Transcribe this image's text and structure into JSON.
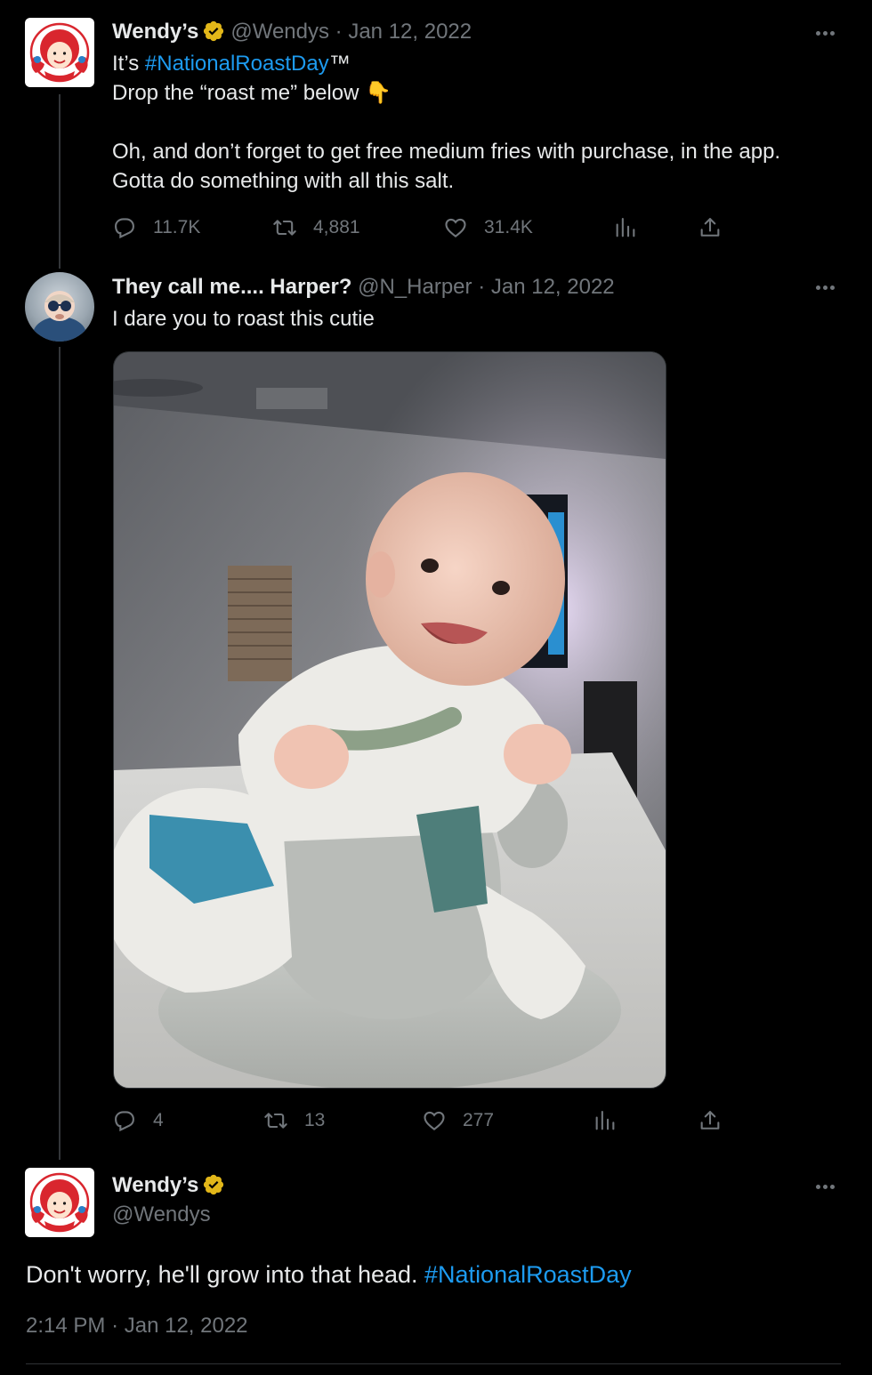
{
  "tweet1": {
    "author_name": "Wendy’s",
    "handle": "@Wendys",
    "separator": "·",
    "date": "Jan 12, 2022",
    "line1_prefix": "It’s ",
    "line1_hashtag": "#NationalRoastDay",
    "line1_suffix": "™",
    "line2_text": "Drop the “roast me” below ",
    "line2_emoji": "👇",
    "line3": "Oh, and don’t forget to get free medium fries with purchase, in the app.",
    "line4": "Gotta do something with all this salt.",
    "replies": "11.7K",
    "retweets": "4,881",
    "likes": "31.4K",
    "avatar_icon": "wendys-logo-icon"
  },
  "tweet2": {
    "author_name": "They call me.... Harper?",
    "handle": "@N_Harper",
    "separator": "·",
    "date": "Jan 12, 2022",
    "text": "I dare you to roast this cutie",
    "replies": "4",
    "retweets": "13",
    "likes": "277",
    "media_icon": "baby-photo"
  },
  "tweet3": {
    "author_name": "Wendy’s",
    "handle": "@Wendys",
    "text_prefix": "Don't worry, he'll grow into that head. ",
    "text_hashtag": "#NationalRoastDay",
    "time": "2:14 PM",
    "separator": "·",
    "date": "Jan 12, 2022"
  },
  "colors": {
    "background": "#000000",
    "text": "#e7e9ea",
    "muted": "#71767b",
    "accent": "#1d9bf0",
    "verified": "#e2b719"
  }
}
